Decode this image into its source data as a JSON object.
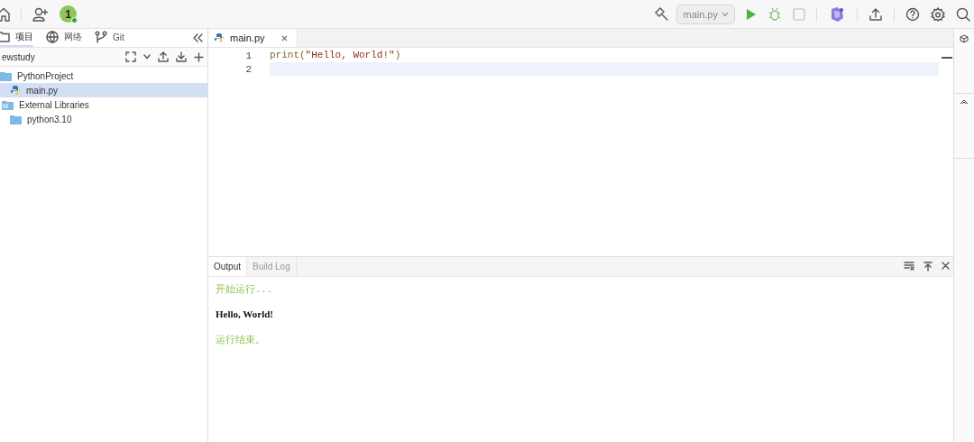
{
  "toolbar": {
    "avatar": "1",
    "run_config": "main.py"
  },
  "sidebar": {
    "tabs": [
      {
        "label": "项目",
        "selected": true
      },
      {
        "label": "网络",
        "selected": false
      },
      {
        "label": "Git",
        "selected": false
      }
    ],
    "project": "ewstudy",
    "tree": [
      {
        "label": "PythonProject",
        "kind": "folder",
        "selected": false,
        "children": [
          {
            "label": "main.py",
            "kind": "python",
            "selected": true
          }
        ]
      },
      {
        "label": "External Libraries",
        "kind": "library",
        "selected": false,
        "children": [
          {
            "label": "python3.10",
            "kind": "folder",
            "selected": false
          }
        ]
      }
    ]
  },
  "editor": {
    "tabs": [
      {
        "label": "main.py",
        "selected": true
      }
    ],
    "lines": [
      {
        "number": "1",
        "current": false,
        "tokens": [
          {
            "text": "print(",
            "kind": "plain"
          },
          {
            "text": "\"Hello, World!\"",
            "kind": "string"
          },
          {
            "text": ")",
            "kind": "plain"
          }
        ]
      },
      {
        "number": "2",
        "current": true
      }
    ]
  },
  "output": {
    "tabs": [
      {
        "label": "Output",
        "selected": true
      },
      {
        "label": "Build Log",
        "selected": false
      }
    ],
    "lines": [
      {
        "text": "开始运行...",
        "kind": "info"
      },
      {
        "text": "Hello, World!",
        "kind": "stdout"
      },
      {
        "text": "运行结束。",
        "kind": "info"
      }
    ]
  }
}
